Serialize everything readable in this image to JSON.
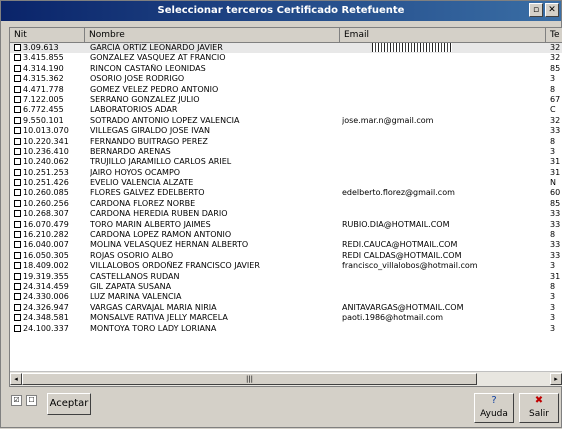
{
  "window": {
    "title": "Seleccionar terceros Certificado Retefuente"
  },
  "columns": {
    "nit": "Nit",
    "nombre": "Nombre",
    "email": "Email",
    "extra": "Te"
  },
  "rows": [
    {
      "nit": "3.09.613",
      "nombre": "GARCIA ORTIZ LEONARDO JAVIER",
      "email": "",
      "extra": "32"
    },
    {
      "nit": "3.415.855",
      "nombre": "GONZALEZ VASQUEZ AT FRANCIO",
      "email": "",
      "extra": "32"
    },
    {
      "nit": "4.314.190",
      "nombre": "RINCON CASTAÑO LEONIDAS",
      "email": "",
      "extra": "85"
    },
    {
      "nit": "4.315.362",
      "nombre": "OSORIO JOSE RODRIGO",
      "email": "",
      "extra": "3"
    },
    {
      "nit": "4.471.778",
      "nombre": "GOMEZ VELEZ PEDRO ANTONIO",
      "email": "",
      "extra": "8"
    },
    {
      "nit": "7.122.005",
      "nombre": "SERRANO GONZALEZ JULIO",
      "email": "",
      "extra": "67"
    },
    {
      "nit": "6.772.455",
      "nombre": "LABORATORIOS ADAR",
      "email": "",
      "extra": "C"
    },
    {
      "nit": "9.550.101",
      "nombre": "SOTRADO ANTONIO LOPEZ VALENCIA",
      "email": "jose.mar.n@gmail.com",
      "extra": "32"
    },
    {
      "nit": "10.013.070",
      "nombre": "VILLEGAS GIRALDO JOSE IVAN",
      "email": "",
      "extra": "33"
    },
    {
      "nit": "10.220.341",
      "nombre": "FERNANDO BUITRAGO PEREZ",
      "email": "",
      "extra": "8"
    },
    {
      "nit": "10.236.410",
      "nombre": "BERNARDO ARENAS",
      "email": "",
      "extra": "3"
    },
    {
      "nit": "10.240.062",
      "nombre": "TRUJILLO JARAMILLO CARLOS ARIEL",
      "email": "",
      "extra": "31"
    },
    {
      "nit": "10.251.253",
      "nombre": "JAIRO HOYOS OCAMPO",
      "email": "",
      "extra": "31"
    },
    {
      "nit": "10.251.426",
      "nombre": "EVELIO VALENCIA ALZATE",
      "email": "",
      "extra": "N"
    },
    {
      "nit": "10.260.085",
      "nombre": "FLORES GALVEZ EDELBERTO",
      "email": "edelberto.florez@gmail.com",
      "extra": "60"
    },
    {
      "nit": "10.260.256",
      "nombre": "CARDONA FLOREZ NORBE",
      "email": "",
      "extra": "85"
    },
    {
      "nit": "10.268.307",
      "nombre": "CARDONA HEREDIA RUBEN DARIO",
      "email": "",
      "extra": "33"
    },
    {
      "nit": "16.070.479",
      "nombre": "TORO MARIN ALBERTO JAIMES",
      "email": "RUBIO.DIA@HOTMAIL.COM",
      "extra": "33"
    },
    {
      "nit": "16.210.282",
      "nombre": "CARDONA LOPEZ RAMON ANTONIO",
      "email": "",
      "extra": "8"
    },
    {
      "nit": "16.040.007",
      "nombre": "MOLINA VELASQUEZ HERNAN ALBERTO",
      "email": "REDI.CAUCA@HOTMAIL.COM",
      "extra": "33"
    },
    {
      "nit": "16.050.305",
      "nombre": "ROJAS OSORIO ALBO",
      "email": "REDI CALDAS@HOTMAIL.COM",
      "extra": "33"
    },
    {
      "nit": "18.409.002",
      "nombre": "VILLALOBOS ORDOÑEZ FRANCISCO JAVIER",
      "email": "francisco_villalobos@hotmail.com",
      "extra": "3"
    },
    {
      "nit": "19.319.355",
      "nombre": "CASTELLANOS RUDAN",
      "email": "",
      "extra": "31"
    },
    {
      "nit": "24.314.459",
      "nombre": "GIL ZAPATA SUSANA",
      "email": "",
      "extra": "8"
    },
    {
      "nit": "24.330.006",
      "nombre": "LUZ MARINA VALENCIA",
      "email": "",
      "extra": "3"
    },
    {
      "nit": "24.326.947",
      "nombre": "VARGAS CARVAJAL MARIA NIRIA",
      "email": "ANITAVARGAS@HOTMAIL.COM",
      "extra": "3"
    },
    {
      "nit": "24.348.581",
      "nombre": "MONSALVE RATIVA JELLY MARCELA",
      "email": "paoti.1986@hotmail.com",
      "extra": "3"
    },
    {
      "nit": "24.100.337",
      "nombre": "MONTOYA TORO LADY LORIANA",
      "email": "",
      "extra": "3"
    }
  ],
  "footer": {
    "accept_label": "Aceptar",
    "help_label": "Ayuda",
    "exit_label": "Salir"
  }
}
